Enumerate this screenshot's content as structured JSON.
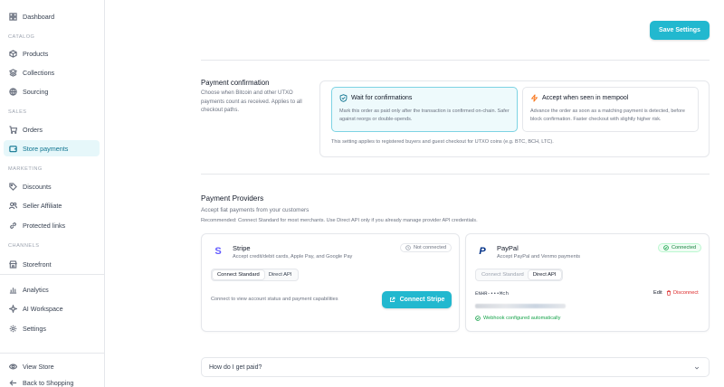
{
  "sidebar": {
    "top_items": [
      {
        "label": "Dashboard",
        "icon": "grid-icon"
      }
    ],
    "catalog_label": "CATALOG",
    "catalog_items": [
      {
        "label": "Products",
        "icon": "box-icon"
      },
      {
        "label": "Collections",
        "icon": "layers-icon"
      },
      {
        "label": "Sourcing",
        "icon": "globe-icon"
      }
    ],
    "sales_label": "SALES",
    "sales_items": [
      {
        "label": "Orders",
        "icon": "cart-icon"
      },
      {
        "label": "Store payments",
        "icon": "wallet-icon",
        "active": true
      }
    ],
    "marketing_label": "MARKETING",
    "marketing_items": [
      {
        "label": "Discounts",
        "icon": "tag-icon"
      },
      {
        "label": "Seller Affiliate",
        "icon": "users-icon"
      },
      {
        "label": "Protected links",
        "icon": "link-icon"
      }
    ],
    "channels_label": "CHANNELS",
    "channels_items": [
      {
        "label": "Storefront",
        "icon": "store-icon"
      }
    ],
    "other_items": [
      {
        "label": "Analytics",
        "icon": "chart-icon"
      },
      {
        "label": "AI Workspace",
        "icon": "sparkle-icon"
      },
      {
        "label": "Settings",
        "icon": "gear-icon"
      }
    ],
    "footer_items": [
      {
        "label": "View Store",
        "icon": "eye-icon"
      },
      {
        "label": "Back to Shopping",
        "icon": "arrow-left-icon"
      }
    ]
  },
  "header": {
    "save_label": "Save Settings"
  },
  "confirmation": {
    "title": "Payment confirmation",
    "description": "Choose when Bitcoin and other UTXO payments count as received. Applies to all checkout paths.",
    "options": [
      {
        "title": "Wait for confirmations",
        "desc": "Mark this order as paid only after the transaction is confirmed on-chain. Safer against reorgs or double-spends.",
        "icon": "shield-icon",
        "selected": true
      },
      {
        "title": "Accept when seen in mempool",
        "desc": "Advance the order as soon as a matching payment is detected, before block confirmation. Faster checkout with slightly higher risk.",
        "icon": "bolt-icon",
        "selected": false
      }
    ],
    "note": "This setting applies to registered buyers and guest checkout for UTXO coins (e.g. BTC, BCH, LTC)."
  },
  "providers": {
    "title": "Payment Providers",
    "subtitle": "Accept fiat payments from your customers",
    "recommendation": "Recommended: Connect Standard for most merchants. Use Direct API only if you already manage provider API credentials.",
    "stripe": {
      "name": "Stripe",
      "desc": "Accept credit/debit cards, Apple Pay, and Google Pay",
      "status": "Not connected",
      "tabs": [
        "Connect Standard",
        "Direct API"
      ],
      "hint": "Connect to view account status and payment capabilities",
      "button": "Connect Stripe",
      "logo_letter": "S",
      "brand_color": "#635bff"
    },
    "paypal": {
      "name": "PayPal",
      "desc": "Accept PayPal and Venmo payments",
      "status": "Connected",
      "tabs": [
        "Connect Standard",
        "Direct API"
      ],
      "credential": "ENHR-•••Mch",
      "edit": "Edit",
      "disconnect": "Disconnect",
      "webhook": "Webhook configured automatically",
      "logo_letter": "P",
      "brand_color": "#003087"
    }
  },
  "faq": {
    "question": "How do I get paid?"
  },
  "colors": {
    "accent": "#22b8cf",
    "success": "#16a34a",
    "danger": "#dc2626"
  }
}
